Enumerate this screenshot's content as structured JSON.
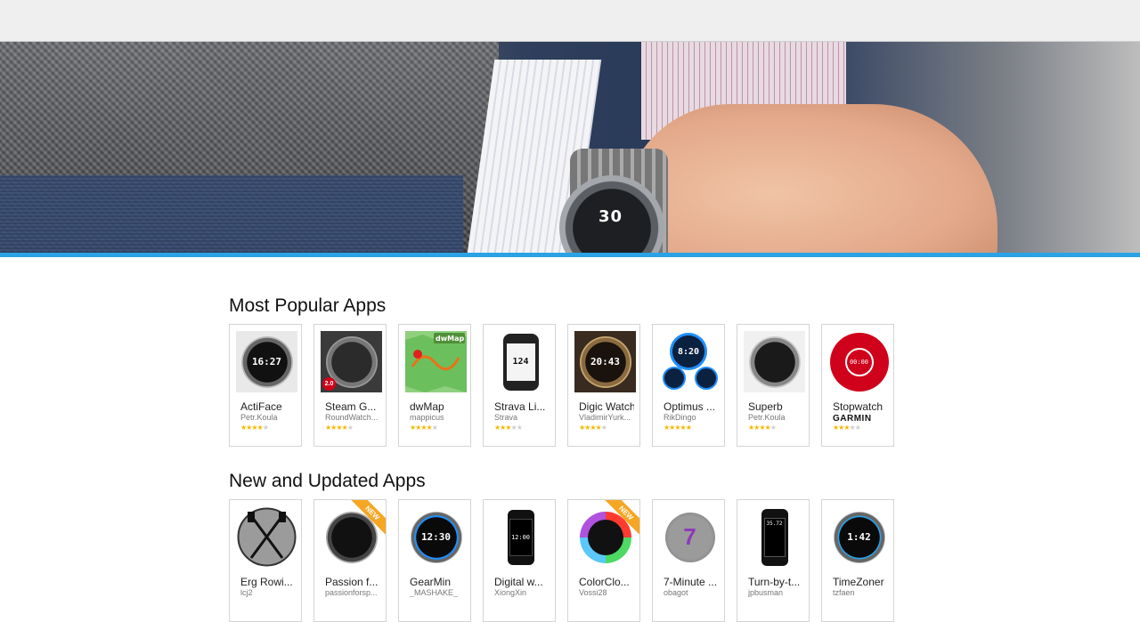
{
  "hero": {
    "watch_time": "30"
  },
  "popular": {
    "title": "Most Popular Apps",
    "apps": [
      {
        "name": "ActiFace",
        "developer": "Petr.Koula",
        "rating": 4,
        "face_text": "16:27"
      },
      {
        "name": "Steam G...",
        "developer": "RoundWatch...",
        "rating": 4,
        "face_text": "2.0"
      },
      {
        "name": "dwMap",
        "developer": "mappicus",
        "rating": 4,
        "face_text": "dwMap"
      },
      {
        "name": "Strava Li...",
        "developer": "Strava",
        "rating": 3,
        "face_text": "124"
      },
      {
        "name": "Digic Watch",
        "developer": "VladimirYurk...",
        "rating": 4,
        "face_text": "20:43"
      },
      {
        "name": "Optimus ...",
        "developer": "RikDingo",
        "rating": 5,
        "face_text": "8:20"
      },
      {
        "name": "Superb",
        "developer": "Petr.Koula",
        "rating": 4,
        "face_text": ""
      },
      {
        "name": "Stopwatch",
        "developer": "GARMIN",
        "rating": 3,
        "face_text": "00:00"
      }
    ]
  },
  "updated": {
    "title": "New and Updated Apps",
    "new_label": "NEW",
    "apps": [
      {
        "name": "Erg Rowi...",
        "developer": "lcj2",
        "face_text": ""
      },
      {
        "name": "Passion f...",
        "developer": "passionforsp...",
        "face_text": "",
        "is_new": true
      },
      {
        "name": "GearMin",
        "developer": "_MASHAKE_",
        "face_text": "12:30"
      },
      {
        "name": "Digital w...",
        "developer": "XiongXin",
        "face_text": "12:00"
      },
      {
        "name": "ColorClo...",
        "developer": "Vossi28",
        "face_text": "",
        "is_new": true
      },
      {
        "name": "7-Minute ...",
        "developer": "obagot",
        "face_text": "7"
      },
      {
        "name": "Turn-by-t...",
        "developer": "jpbusman",
        "face_text": "35.72"
      },
      {
        "name": "TimeZoner",
        "developer": "tzfaen",
        "face_text": "1:42"
      }
    ]
  },
  "colors": {
    "accent": "#29a3e6",
    "star": "#f5b800",
    "new_ribbon": "#f5a623"
  }
}
